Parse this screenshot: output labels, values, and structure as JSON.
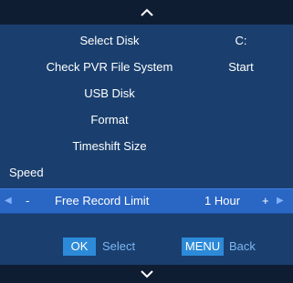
{
  "menu": {
    "items": [
      {
        "label": "Select Disk",
        "value": "C:"
      },
      {
        "label": "Check PVR File System",
        "value": "Start"
      },
      {
        "label": "USB Disk",
        "value": ""
      },
      {
        "label": "Format",
        "value": ""
      },
      {
        "label": "Timeshift Size",
        "value": ""
      },
      {
        "label": "Speed",
        "value": ""
      }
    ],
    "selected": {
      "label": "Free Record Limit",
      "value": "1 Hour",
      "decrement": "-",
      "increment": "+"
    }
  },
  "footer": {
    "ok_key": "OK",
    "ok_hint": "Select",
    "menu_key": "MENU",
    "menu_hint": "Back"
  },
  "colors": {
    "panel": "#1a3f6e",
    "bar": "#0f1d33",
    "selected_row": "#2a66c4",
    "key": "#2c8ad8",
    "hint_text": "#7cb7f4"
  },
  "icons": {
    "top": "chevron-up-icon",
    "bottom": "chevron-down-icon",
    "left": "triangle-left-icon",
    "right": "triangle-right-icon"
  }
}
